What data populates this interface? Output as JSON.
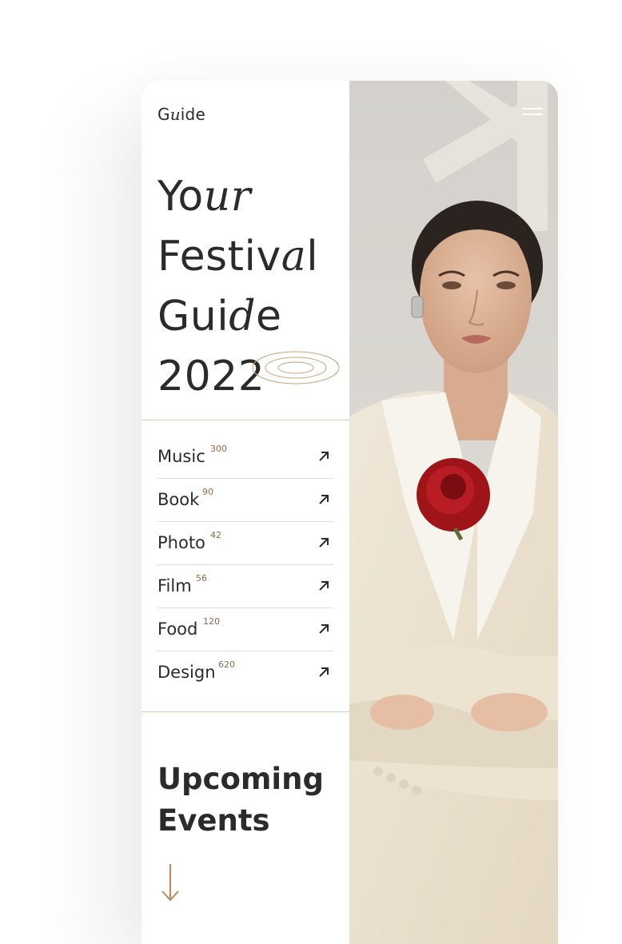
{
  "brand": {
    "logo_prefix": "G",
    "logo_italic": "u",
    "logo_suffix": "ide"
  },
  "hero": {
    "line1_a": "Yo",
    "line1_b": "ur",
    "line1_c": "",
    "line2_a": "Festiv",
    "line2_b": "a",
    "line2_c": "l",
    "line3_a": "Gui",
    "line3_b": "d",
    "line3_c": "e",
    "line4": "2022"
  },
  "categories": [
    {
      "label": "Music",
      "count": "300"
    },
    {
      "label": "Book",
      "count": "90"
    },
    {
      "label": "Photo",
      "count": "42"
    },
    {
      "label": "Film",
      "count": "56"
    },
    {
      "label": "Food",
      "count": "120"
    },
    {
      "label": "Design",
      "count": "620"
    }
  ],
  "upcoming": {
    "line1": "Upcoming",
    "line2": "Events"
  },
  "icons": {
    "menu": "hamburger-menu-icon",
    "category_arrow": "arrow-up-right-icon",
    "scroll_arrow": "arrow-down-icon"
  },
  "colors": {
    "accent": "#b88a5d",
    "text": "#2b2b2b",
    "divider": "#e2cbb0"
  }
}
